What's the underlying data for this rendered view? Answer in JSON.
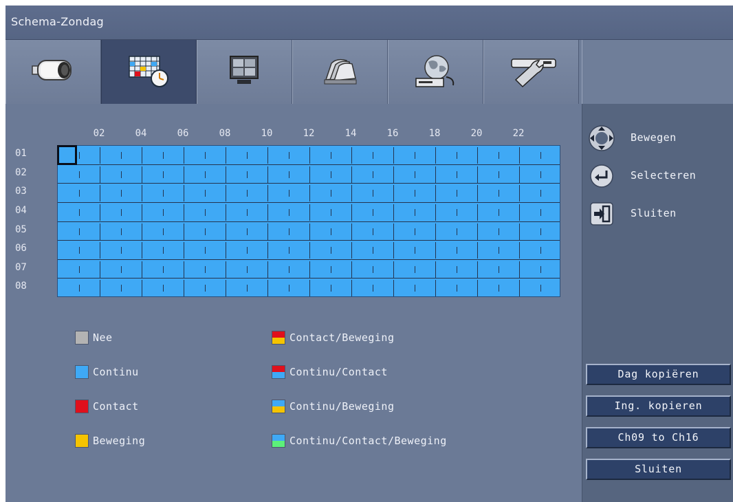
{
  "window": {
    "title": "Schema-Zondag"
  },
  "tabs": [
    {
      "icon": "camera-icon",
      "active": false
    },
    {
      "icon": "schedule-calendar-icon",
      "active": true
    },
    {
      "icon": "monitor-icon",
      "active": false
    },
    {
      "icon": "storage-stack-icon",
      "active": false
    },
    {
      "icon": "network-globe-icon",
      "active": false
    },
    {
      "icon": "tools-wrench-icon",
      "active": false
    }
  ],
  "schedule": {
    "hour_labels": [
      "02",
      "04",
      "06",
      "08",
      "10",
      "12",
      "14",
      "16",
      "18",
      "20",
      "22"
    ],
    "row_labels": [
      "01",
      "02",
      "03",
      "04",
      "05",
      "06",
      "07",
      "08"
    ],
    "fill_mode": "Continu",
    "fill_color": "#3fa9f5"
  },
  "legend": [
    {
      "label": "Nee",
      "colors": [
        "#b3b3b3"
      ]
    },
    {
      "label": "Continu",
      "colors": [
        "#3fa9f5"
      ]
    },
    {
      "label": "Contact",
      "colors": [
        "#e0101c"
      ]
    },
    {
      "label": "Beweging",
      "colors": [
        "#f5c400"
      ]
    },
    {
      "label": "Contact/Beweging",
      "colors": [
        "#e0101c",
        "#f5c400"
      ]
    },
    {
      "label": "Continu/Contact",
      "colors": [
        "#e0101c",
        "#3fa9f5"
      ]
    },
    {
      "label": "Continu/Beweging",
      "colors": [
        "#3fa9f5",
        "#f5c400"
      ]
    },
    {
      "label": "Continu/Contact/Beweging",
      "colors": [
        "#3fa9f5",
        "#5cf07a"
      ]
    }
  ],
  "hints": [
    {
      "icon": "dpad-icon",
      "label": "Bewegen"
    },
    {
      "icon": "enter-icon",
      "label": "Selecteren"
    },
    {
      "icon": "exit-icon",
      "label": "Sluiten"
    }
  ],
  "actions": {
    "copy_day": "Dag kopiëren",
    "copy_settings": "Ing. kopieren",
    "channel_range": "Ch09 to Ch16",
    "close": "Sluiten"
  }
}
